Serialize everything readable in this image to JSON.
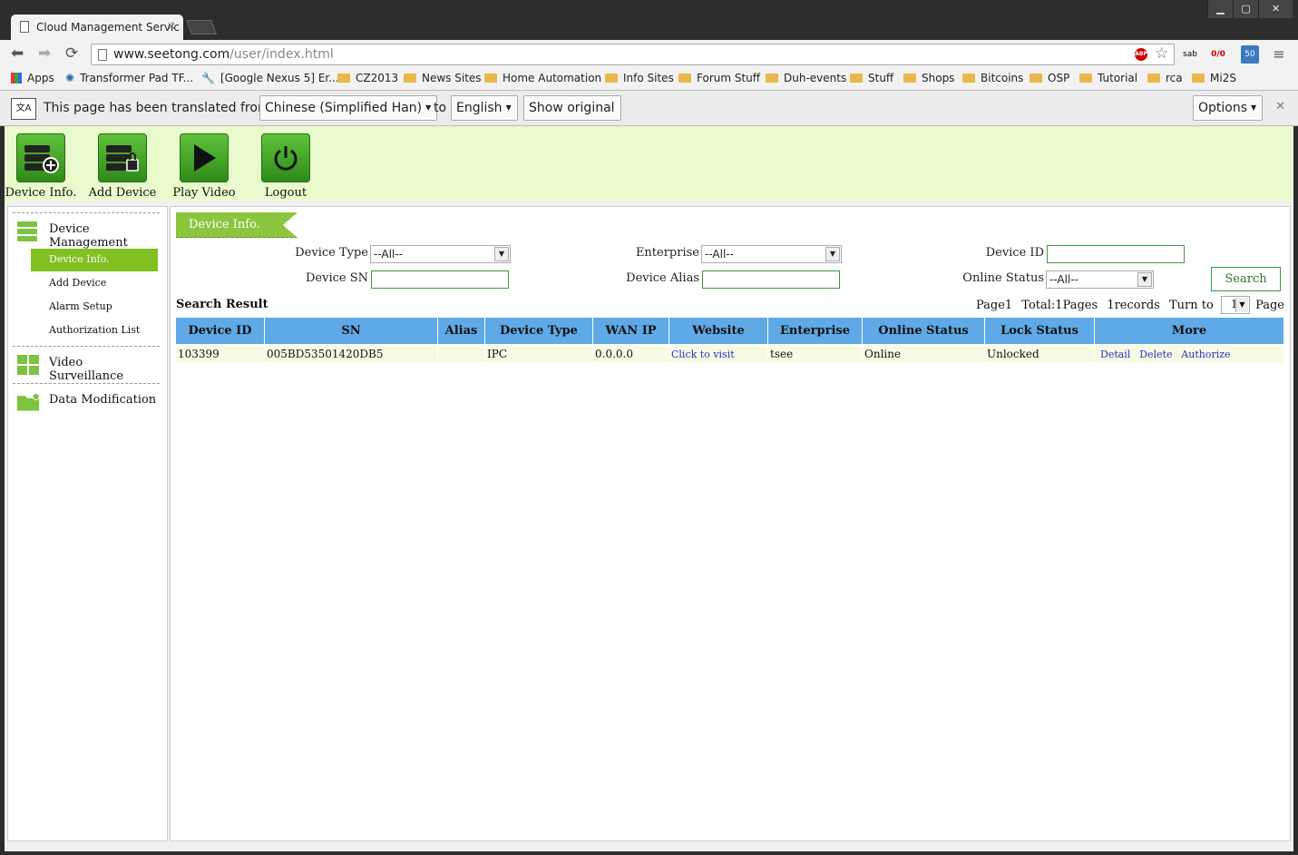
{
  "browser": {
    "tab_title": "Cloud Management Servic",
    "url_host": "www.seetong.com",
    "url_path": "/user/index.html",
    "bookmarks": [
      {
        "label": "Apps",
        "kind": "apps"
      },
      {
        "label": "Transformer Pad TF...",
        "kind": "site"
      },
      {
        "label": "[Google Nexus 5] Er...",
        "kind": "site"
      },
      {
        "label": "CZ2013",
        "kind": "folder"
      },
      {
        "label": "News Sites",
        "kind": "folder"
      },
      {
        "label": "Home Automation",
        "kind": "folder"
      },
      {
        "label": "Info Sites",
        "kind": "folder"
      },
      {
        "label": "Forum Stuff",
        "kind": "folder"
      },
      {
        "label": "Duh-events",
        "kind": "folder"
      },
      {
        "label": "Stuff",
        "kind": "folder"
      },
      {
        "label": "Shops",
        "kind": "folder"
      },
      {
        "label": "Bitcoins",
        "kind": "folder"
      },
      {
        "label": "OSP",
        "kind": "folder"
      },
      {
        "label": "Tutorial",
        "kind": "folder"
      },
      {
        "label": "rca",
        "kind": "folder"
      },
      {
        "label": "Mi2S",
        "kind": "folder"
      }
    ],
    "ext_badges": {
      "sab": "sab",
      "counter": "0/0",
      "mail": "50"
    },
    "abp": "ABP"
  },
  "translate_bar": {
    "text": "This page has been translated from",
    "from_lang": "Chinese (Simplified Han)",
    "to_word": "to",
    "to_lang": "English",
    "show_original": "Show original",
    "options": "Options"
  },
  "topnav": [
    {
      "label": "Device Info.",
      "icon": "server-add-icon"
    },
    {
      "label": "Add Device",
      "icon": "server-lock-icon"
    },
    {
      "label": "Play Video",
      "icon": "play-icon"
    },
    {
      "label": "Logout",
      "icon": "power-icon"
    }
  ],
  "sidebar": {
    "device_management": "Device Management",
    "items": [
      "Device Info.",
      "Add Device",
      "Alarm Setup",
      "Authorization List"
    ],
    "video_surveillance": "Video Surveillance",
    "data_modification": "Data Modification"
  },
  "main": {
    "section_title": "Device Info.",
    "filters": {
      "device_type_label": "Device Type",
      "device_type_value": "--All--",
      "enterprise_label": "Enterprise",
      "enterprise_value": "--All--",
      "device_id_label": "Device ID",
      "device_sn_label": "Device SN",
      "device_alias_label": "Device Alias",
      "online_status_label": "Online Status",
      "online_status_value": "--All--",
      "search": "Search"
    },
    "search_result": "Search Result",
    "pager": {
      "page": "Page1",
      "total": "Total:1Pages",
      "records": "1records",
      "turn_to": "Turn to",
      "page_value": "1",
      "page_word": "Page"
    },
    "columns": [
      "Device ID",
      "SN",
      "Alias",
      "Device Type",
      "WAN IP",
      "Website",
      "Enterprise",
      "Online Status",
      "Lock Status",
      "More"
    ],
    "rows": [
      {
        "device_id": "103399",
        "sn": "005BD53501420DB5",
        "alias": "",
        "device_type": "IPC",
        "wan_ip": "0.0.0.0",
        "website": "Click to visit",
        "enterprise": "tsee",
        "online_status": "Online",
        "lock_status": "Unlocked",
        "actions": [
          "Detail",
          "Delete",
          "Authorize"
        ]
      }
    ]
  }
}
